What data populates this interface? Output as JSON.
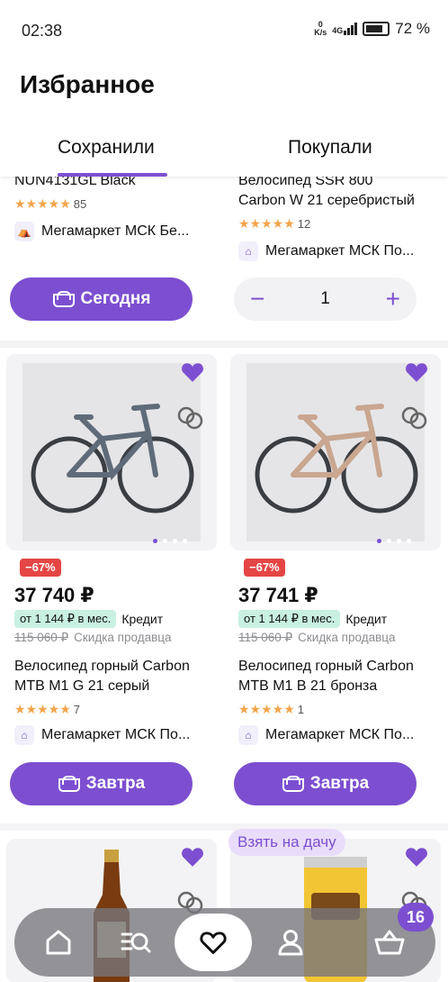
{
  "status": {
    "time": "02:38",
    "net_speed": "0\nK/s",
    "network": "4G",
    "battery": "72 %"
  },
  "page": {
    "title": "Избранное"
  },
  "tabs": {
    "saved": "Сохранили",
    "bought": "Покупали"
  },
  "top_row": {
    "left": {
      "name": "NUN4131GL Black",
      "reviews": "85",
      "seller": "Мегамаркет МСК Бе...",
      "button": "Сегодня"
    },
    "right": {
      "name": "Велосипед SSR 800 Carbon W 21 серебристый",
      "name_line1": "Велосипед SSR 800",
      "name_line2": "Carbon W 21 серебристый",
      "reviews": "12",
      "seller": "Мегамаркет МСК По...",
      "quantity": "1",
      "minus": "−",
      "plus": "+"
    }
  },
  "products": [
    {
      "discount": "−67%",
      "price": "37 740 ₽",
      "credit": "от 1 144 ₽ в мес.",
      "credit_label": "Кредит",
      "old_price": "115 060 ₽",
      "seller_discount": "Скидка продавца",
      "name_line1": "Велосипед горный Carbon",
      "name_line2": "MTB M1 G 21 серый",
      "reviews": "7",
      "seller": "Мегамаркет МСК По...",
      "button": "Завтра",
      "frame_color": "#5f6b78"
    },
    {
      "discount": "−67%",
      "price": "37 741 ₽",
      "credit": "от 1 144 ₽ в мес.",
      "credit_label": "Кредит",
      "old_price": "115 060 ₽",
      "seller_discount": "Скидка продавца",
      "name_line1": "Велосипед горный Carbon",
      "name_line2": "MTB M1 B 21 бронза",
      "reviews": "1",
      "seller": "Мегамаркет МСК По...",
      "button": "Завтра",
      "frame_color": "#c9a690"
    }
  ],
  "promo_badge": "Взять на дачу",
  "nav": {
    "cart_count": "16"
  },
  "colors": {
    "accent": "#7c4fd0",
    "discount": "#e64545",
    "stars": "#f3a44a",
    "credit_bg": "#c9f1e2"
  }
}
